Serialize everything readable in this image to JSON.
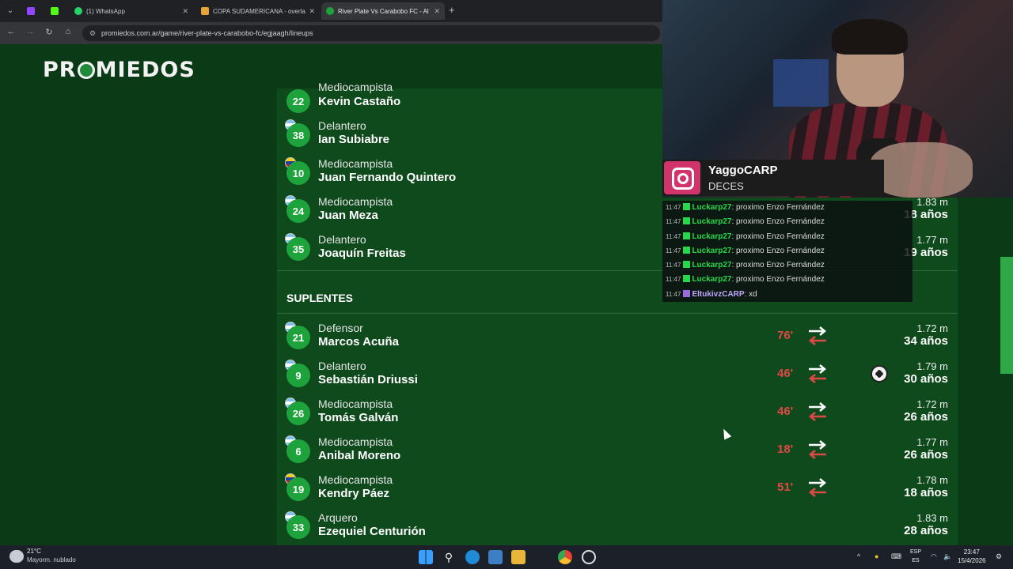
{
  "browser": {
    "tabs": [
      {
        "label": "",
        "icon": "twitch-icon"
      },
      {
        "label": "",
        "icon": "kick-icon"
      },
      {
        "label": "(1) WhatsApp",
        "icon": "whatsapp-icon"
      },
      {
        "label": "COPA SUDAMERICANA - overla",
        "icon": "sudamericana-icon"
      },
      {
        "label": "River Plate Vs Carabobo FC - Al",
        "icon": "promiedos-icon",
        "active": true
      }
    ],
    "url": "promiedos.com.ar/game/river-plate-vs-carabobo-fc/egjaagh/lineups"
  },
  "site": {
    "logo": "PROMIEDOS"
  },
  "starters": [
    {
      "number": "22",
      "position": "Mediocampista",
      "name": "Kevin Castaño",
      "flag": "ar"
    },
    {
      "number": "38",
      "position": "Delantero",
      "name": "Ian Subiabre",
      "flag": "ar"
    },
    {
      "number": "10",
      "position": "Mediocampista",
      "name": "Juan Fernando Quintero",
      "flag": "co"
    },
    {
      "number": "24",
      "position": "Mediocampista",
      "name": "Juan Meza",
      "flag": "ar",
      "height": "1.83 m",
      "age": "18 años"
    },
    {
      "number": "35",
      "position": "Delantero",
      "name": "Joaquín Freitas",
      "flag": "ar",
      "height": "1.77 m",
      "age": "19 años"
    }
  ],
  "subs_title": "SUPLENTES",
  "subs": [
    {
      "number": "21",
      "position": "Defensor",
      "name": "Marcos Acuña",
      "minute": "76'",
      "height": "1.72 m",
      "age": "34 años",
      "goal": false,
      "flag": "ar"
    },
    {
      "number": "9",
      "position": "Delantero",
      "name": "Sebastián Driussi",
      "minute": "46'",
      "height": "1.79 m",
      "age": "30 años",
      "goal": true,
      "flag": "ar"
    },
    {
      "number": "26",
      "position": "Mediocampista",
      "name": "Tomás Galván",
      "minute": "46'",
      "height": "1.72 m",
      "age": "26 años",
      "goal": false,
      "flag": "ar"
    },
    {
      "number": "6",
      "position": "Mediocampista",
      "name": "Anibal Moreno",
      "minute": "18'",
      "height": "1.77 m",
      "age": "26 años",
      "goal": false,
      "flag": "ar"
    },
    {
      "number": "19",
      "position": "Mediocampista",
      "name": "Kendry Páez",
      "minute": "51'",
      "height": "1.78 m",
      "age": "18 años",
      "goal": false,
      "flag": "ec"
    },
    {
      "number": "33",
      "position": "Arquero",
      "name": "Ezequiel Centurión",
      "minute": "",
      "height": "1.83 m",
      "age": "28 años",
      "goal": false,
      "flag": "ar"
    }
  ],
  "stream": {
    "instagram_user": "YaggoCARP",
    "instagram_sub": "DECES",
    "chat": [
      {
        "time": "11:47",
        "user": "Luckarp27",
        "message": "proximo Enzo Fernández"
      },
      {
        "time": "11:47",
        "user": "Luckarp27",
        "message": "proximo Enzo Fernández"
      },
      {
        "time": "11:47",
        "user": "Luckarp27",
        "message": "proximo Enzo Fernández"
      },
      {
        "time": "11:47",
        "user": "Luckarp27",
        "message": "proximo Enzo Fernández"
      },
      {
        "time": "11:47",
        "user": "Luckarp27",
        "message": "proximo Enzo Fernández"
      },
      {
        "time": "11:47",
        "user": "Luckarp27",
        "message": "proximo Enzo Fernández"
      },
      {
        "time": "11:47",
        "user": "EltukivzCARP",
        "message": "xd"
      }
    ]
  },
  "taskbar": {
    "temp": "21°C",
    "weather": "Mayorm. nublado",
    "lang_top": "ESP",
    "lang_bottom": "ES",
    "time": "23:47",
    "date": "15/4/2026"
  },
  "colors": {
    "accent_green": "#1ea23c",
    "minute_red": "#e04848",
    "page_bg": "#0b3a16"
  }
}
